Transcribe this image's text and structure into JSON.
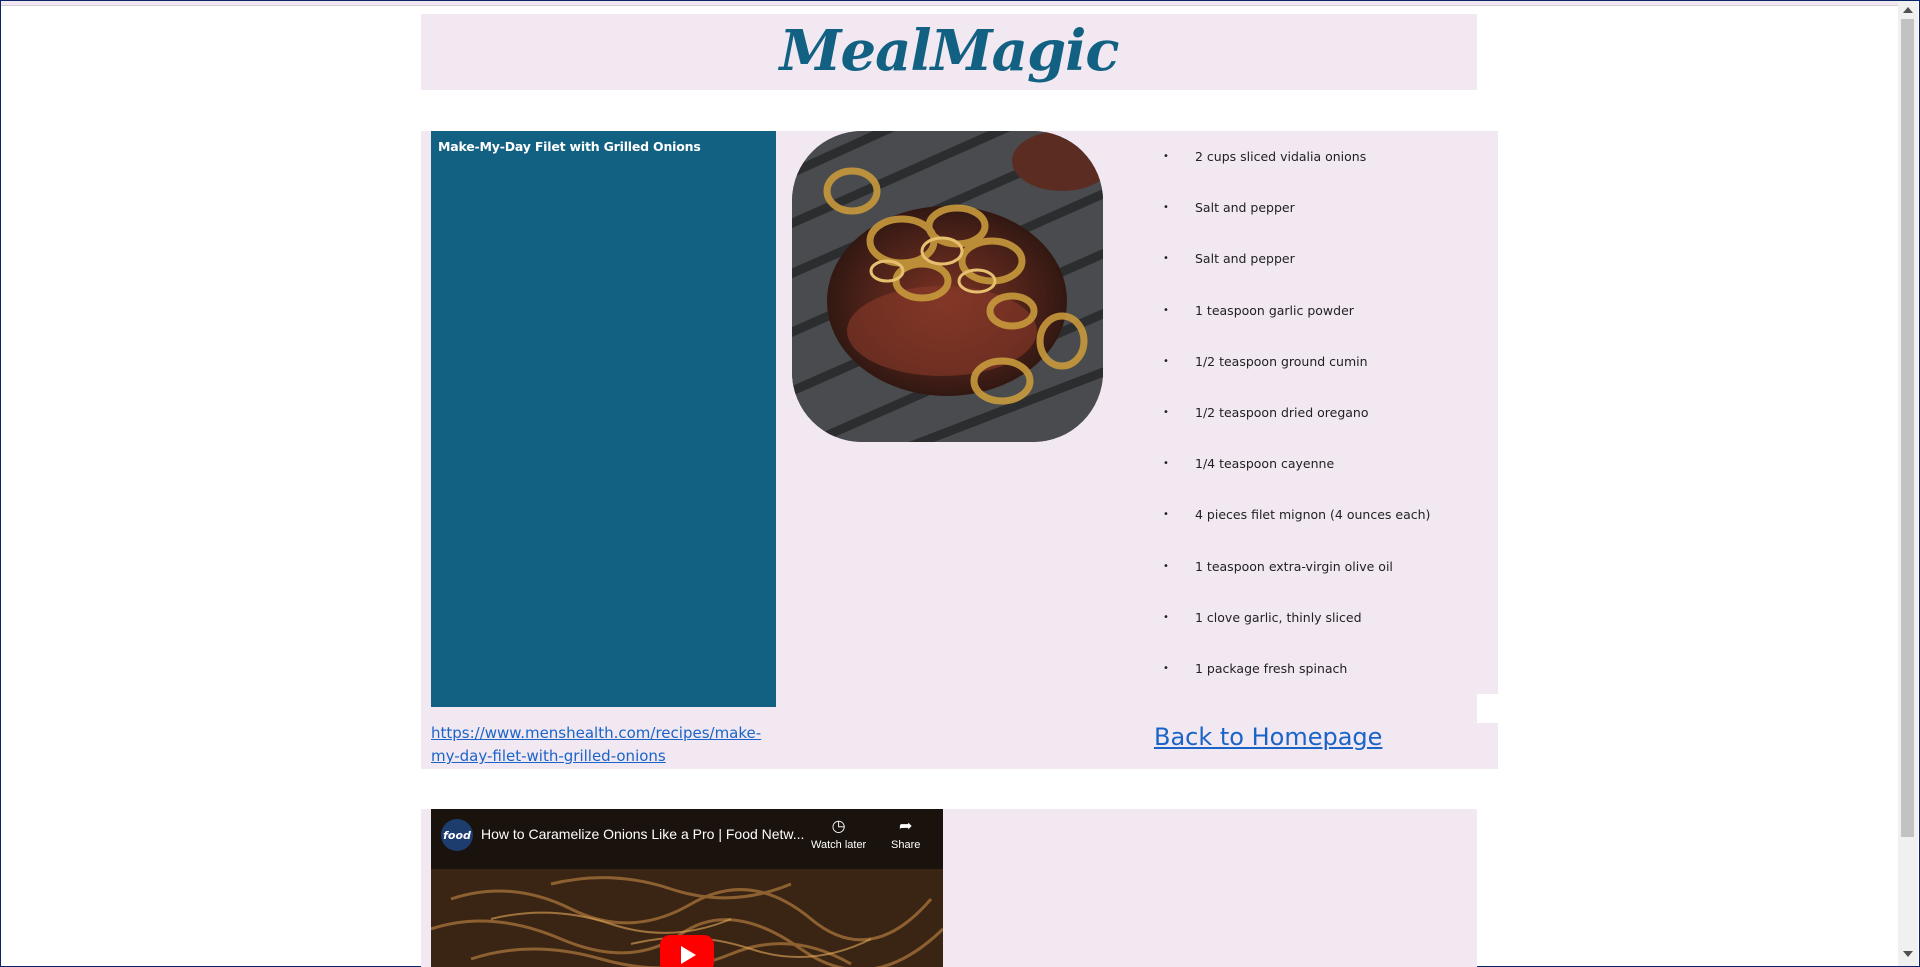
{
  "site": {
    "logo": "MealMagic"
  },
  "recipe": {
    "title": "Make-My-Day Filet with Grilled Onions",
    "photo_alt": "steak-with-grilled-onions",
    "ingredients": [
      "2 cups sliced vidalia onions",
      "Salt and pepper",
      "Salt and pepper",
      "1 teaspoon garlic powder",
      "1/2 teaspoon ground cumin",
      "1/2 teaspoon dried oregano",
      "1/4 teaspoon cayenne",
      "4 pieces filet mignon (4 ounces each)",
      "1 teaspoon extra-virgin olive oil",
      "1 clove garlic, thinly sliced",
      "1 package fresh spinach"
    ],
    "bullet": "•",
    "source_url": "https://www.menshealth.com/recipes/make-my-day-filet-with-grilled-onions",
    "back_label": "Back to Homepage"
  },
  "video": {
    "channel": "food",
    "title": "How to Caramelize Onions Like a Pro | Food Netw...",
    "watch_later": "Watch later",
    "share": "Share"
  },
  "colors": {
    "accent": "#126183",
    "panel": "#f1e8f2",
    "link": "#1a64c8"
  }
}
